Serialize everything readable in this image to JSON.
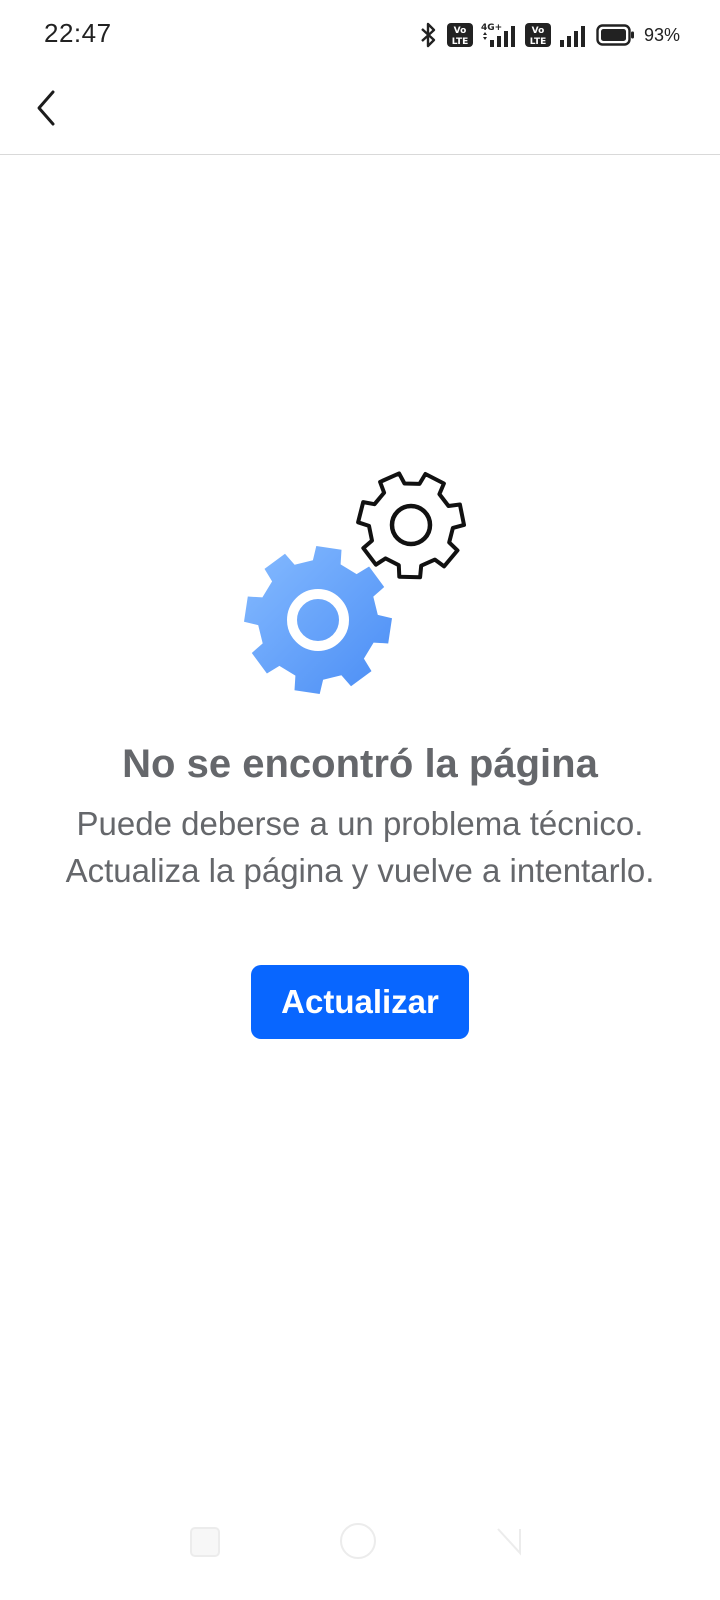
{
  "status_bar": {
    "time": "22:47",
    "network_label": "4G+",
    "volte_label_1": "Vo",
    "volte_label_2": "LTE",
    "battery_percent": "93%",
    "icons": [
      "bluetooth-icon",
      "volte-icon",
      "signal-4g-icon",
      "volte-icon",
      "signal-icon",
      "battery-icon"
    ]
  },
  "app_bar": {
    "back_icon": "chevron-left-icon"
  },
  "illustration": {
    "icons": [
      "gear-blue-icon",
      "gear-outline-icon"
    ],
    "colors": {
      "gear_blue_light": "#7fb5ff",
      "gear_blue_dark": "#4a8df5",
      "gear_outline": "#111111"
    }
  },
  "error": {
    "title": "No se encontró la página",
    "message": "Puede deberse a un problema técnico. Actualiza la página y vuelve a intentarlo.",
    "button_label": "Actualizar"
  },
  "colors": {
    "accent": "#0866ff",
    "text_secondary": "#65676b"
  }
}
